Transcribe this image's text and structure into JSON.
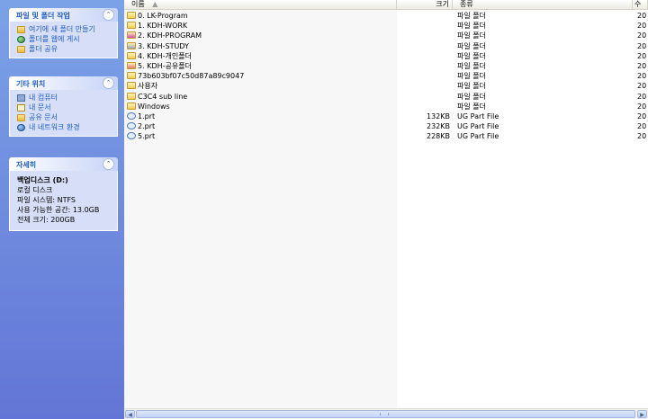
{
  "task_panes": {
    "file_folder_tasks": {
      "title": "파일 및 폴더 작업",
      "links": [
        {
          "label": "여기에 새 폴더 만들기",
          "icon": "new-folder-icon"
        },
        {
          "label": "폴더를 웹에 게시",
          "icon": "web-publish-icon"
        },
        {
          "label": "폴더 공유",
          "icon": "share-folder-icon"
        }
      ]
    },
    "other_places": {
      "title": "기타 위치",
      "links": [
        {
          "label": "내 컴퓨터",
          "icon": "my-computer-icon"
        },
        {
          "label": "내 문서",
          "icon": "my-documents-icon"
        },
        {
          "label": "공유 문서",
          "icon": "shared-documents-icon"
        },
        {
          "label": "내 네트워크 환경",
          "icon": "my-network-icon"
        }
      ]
    },
    "details": {
      "title": "자세히",
      "drive_name": "백업디스크 (D:)",
      "drive_type": "로컬 디스크",
      "file_system": "파일 시스템: NTFS",
      "free_space": "사용 가능한 공간: 13.0GB",
      "total_size": "전체 크기: 200GB"
    }
  },
  "columns": {
    "name": "이름",
    "size": "크기",
    "type": "종류",
    "date": "수"
  },
  "files": [
    {
      "name": "0. LK-Program",
      "size": "",
      "type": "파일 폴더",
      "date": "20",
      "icon": "folder-icon",
      "color": "#f2cf52"
    },
    {
      "name": "1. KDH-WORK",
      "size": "",
      "type": "파일 폴더",
      "date": "20",
      "icon": "folder-icon",
      "color": "#f2cf52"
    },
    {
      "name": "2. KDH-PROGRAM",
      "size": "",
      "type": "파일 폴더",
      "date": "20",
      "icon": "folder-icon",
      "color": "#d64aa8"
    },
    {
      "name": "3. KDH-STUDY",
      "size": "",
      "type": "파일 폴더",
      "date": "20",
      "icon": "folder-icon",
      "color": "#9aa4b8"
    },
    {
      "name": "4. KDH-개인폴더",
      "size": "",
      "type": "파일 폴더",
      "date": "20",
      "icon": "folder-icon",
      "color": "#f2cf52"
    },
    {
      "name": "5. KDH-공유폴더",
      "size": "",
      "type": "파일 폴더",
      "date": "20",
      "icon": "folder-icon",
      "color": "#e07a6a"
    },
    {
      "name": "73b603bf07c50d87a89c9047",
      "size": "",
      "type": "파일 폴더",
      "date": "20",
      "icon": "folder-icon",
      "color": "#f2cf52"
    },
    {
      "name": "사용자",
      "size": "",
      "type": "파일 폴더",
      "date": "20",
      "icon": "folder-icon",
      "color": "#f2cf52"
    },
    {
      "name": "C3C4 sub line",
      "size": "",
      "type": "파일 폴더",
      "date": "20",
      "icon": "folder-icon",
      "color": "#f2cf52"
    },
    {
      "name": "Windows",
      "size": "",
      "type": "파일 폴더",
      "date": "20",
      "icon": "folder-icon",
      "color": "#f2cf52"
    },
    {
      "name": "1.prt",
      "size": "132KB",
      "type": "UG Part File",
      "date": "20",
      "icon": "prt-file-icon",
      "color": "#4a78c8"
    },
    {
      "name": "2.prt",
      "size": "232KB",
      "type": "UG Part File",
      "date": "20",
      "icon": "prt-file-icon",
      "color": "#4a78c8"
    },
    {
      "name": "5.prt",
      "size": "228KB",
      "type": "UG Part File",
      "date": "20",
      "icon": "prt-file-icon",
      "color": "#4a78c8"
    }
  ]
}
